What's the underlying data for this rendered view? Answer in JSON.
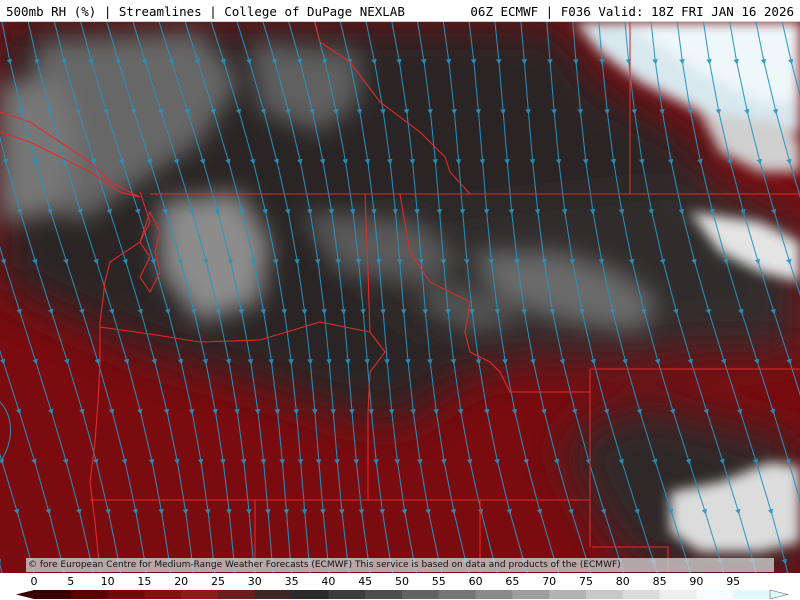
{
  "header": {
    "left_text": "500mb RH (%) | Streamlines | College of DuPage NEXLAB",
    "right_text": "06Z ECMWF | F036 Valid: 18Z FRI JAN 16 2026"
  },
  "credit_text": "© fore European Centre for Medium-Range Weather Forecasts (ECMWF)  This service is based on data and products of the (ECMWF)",
  "colorbar": {
    "ticks": [
      "0",
      "5",
      "10",
      "15",
      "20",
      "25",
      "30",
      "35",
      "40",
      "45",
      "50",
      "55",
      "60",
      "65",
      "70",
      "75",
      "80",
      "85",
      "90",
      "95"
    ],
    "colors": [
      "#3a0000",
      "#5a0000",
      "#720808",
      "#841010",
      "#8e1a1a",
      "#6a1e1e",
      "#3e2626",
      "#2a2a2a",
      "#3c3c3c",
      "#4e4e4e",
      "#626262",
      "#767676",
      "#8a8a8a",
      "#9e9e9e",
      "#b4b4b4",
      "#c8c8c8",
      "#dcdcdc",
      "#eeeeee",
      "#f6fbfd",
      "#e2f8fc"
    ]
  },
  "map": {
    "low_rh_color": "#7a0c10",
    "mid_rh_color": "#2e2e2e",
    "high_rh_color": "#a4a4a4",
    "saturated_color": "#eef7fa",
    "streamline_color": "#2a93c0",
    "border_color": "#e02a2a"
  }
}
